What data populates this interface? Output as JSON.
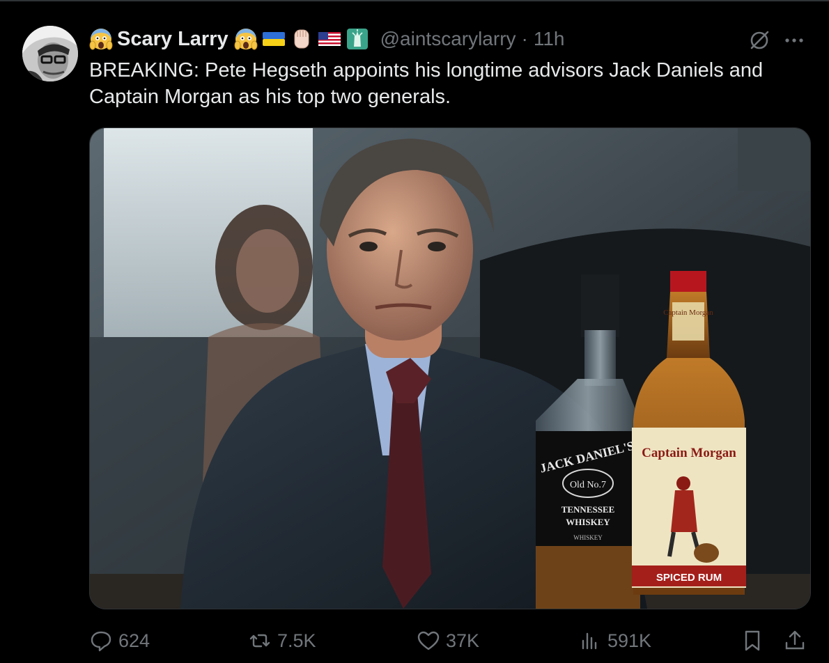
{
  "tweet": {
    "author": {
      "display_name": "Scary Larry",
      "handle": "@aintscarylarry",
      "name_emojis": [
        "scream-emoji",
        "scream-emoji",
        "ukraine-flag-emoji",
        "raised-fist-emoji",
        "us-flag-emoji",
        "statue-of-liberty-emoji"
      ]
    },
    "separator": "·",
    "timestamp": "11h",
    "text": "BREAKING: Pete Hegseth appoints his longtime advisors Jack Daniels and Captain Morgan as his top two generals.",
    "image": {
      "bottle_left": {
        "brand": "JACK DANIEL'S",
        "monogram": "Old No.7",
        "line1": "TENNESSEE",
        "line2": "WHISKEY",
        "line3": "WHISKEY"
      },
      "bottle_right": {
        "neck": "Captain Morgan",
        "brand": "Captain Morgan",
        "footer": "SPICED RUM"
      }
    },
    "actions": {
      "replies": "624",
      "reposts": "7.5K",
      "likes": "37K",
      "views": "591K"
    }
  },
  "icons": {
    "reply": "reply-bubble-icon",
    "repost": "repost-arrows-icon",
    "like": "heart-icon",
    "views": "bar-chart-icon",
    "bookmark": "bookmark-icon",
    "share": "share-upload-icon",
    "grok": "grok-icon",
    "more": "more-dots-icon"
  },
  "colors": {
    "background": "#000000",
    "text": "#e7e9ea",
    "muted": "#71767b",
    "border": "#2f3336"
  }
}
